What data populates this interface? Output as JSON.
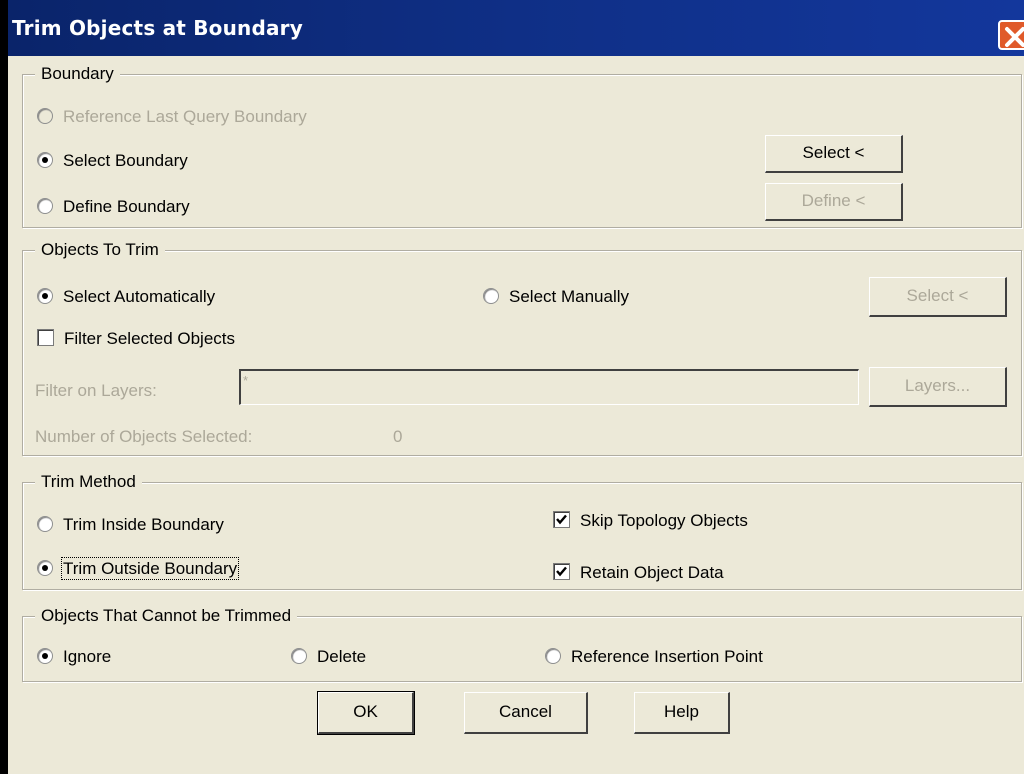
{
  "window": {
    "title": "Trim Objects at Boundary"
  },
  "boundary": {
    "legend": "Boundary",
    "reference_last": "Reference Last Query Boundary",
    "select_boundary": "Select Boundary",
    "define_boundary": "Define Boundary",
    "select_button": "Select <",
    "define_button": "Define <"
  },
  "objects_to_trim": {
    "legend": "Objects To Trim",
    "select_automatically": "Select Automatically",
    "select_manually": "Select Manually",
    "select_button": "Select <",
    "filter_selected": "Filter Selected Objects",
    "filter_layers_label": "Filter on Layers:",
    "filter_layers_value": "*",
    "layers_button": "Layers...",
    "count_label": "Number of Objects Selected:",
    "count_value": "0"
  },
  "trim_method": {
    "legend": "Trim Method",
    "inside": "Trim Inside Boundary",
    "outside": "Trim Outside Boundary",
    "skip_topology": "Skip Topology Objects",
    "retain_data": "Retain Object Data"
  },
  "cannot_trim": {
    "legend": "Objects That Cannot be Trimmed",
    "ignore": "Ignore",
    "delete": "Delete",
    "reference_insertion": "Reference Insertion Point"
  },
  "buttons": {
    "ok": "OK",
    "cancel": "Cancel",
    "help": "Help"
  }
}
